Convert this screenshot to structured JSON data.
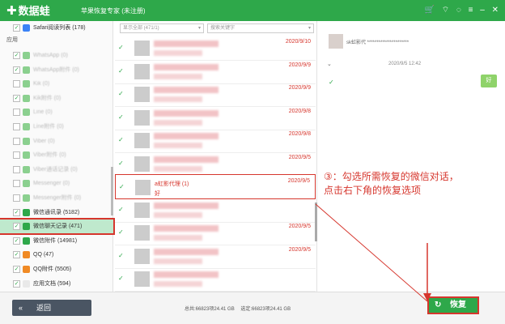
{
  "app": {
    "logo": "数据蛙",
    "title": "苹果恢复专家 (未注册)",
    "window_controls": [
      "cart-icon",
      "wifi-icon",
      "chat-icon",
      "menu-icon",
      "minimize-icon",
      "close-icon"
    ]
  },
  "sidebar": {
    "top_item": "Safari阅读列表 (178)",
    "section": "应用",
    "items": [
      {
        "label": "WhatsApp (0)",
        "checked": true,
        "icon": "app-icon",
        "blurred": true
      },
      {
        "label": "WhatsApp附件 (0)",
        "checked": true,
        "icon": "app-icon",
        "blurred": true
      },
      {
        "label": "Kik (0)",
        "checked": false,
        "icon": "app-icon",
        "blurred": true
      },
      {
        "label": "Kik附件 (0)",
        "checked": true,
        "icon": "app-icon",
        "blurred": true
      },
      {
        "label": "Line (0)",
        "checked": false,
        "icon": "app-icon",
        "blurred": true
      },
      {
        "label": "Line附件 (0)",
        "checked": false,
        "icon": "app-icon",
        "blurred": true
      },
      {
        "label": "Viber (0)",
        "checked": false,
        "icon": "app-icon",
        "blurred": true
      },
      {
        "label": "Viber附件 (0)",
        "checked": false,
        "icon": "app-icon",
        "blurred": true
      },
      {
        "label": "Viber通话记录 (0)",
        "checked": false,
        "icon": "app-icon",
        "blurred": true
      },
      {
        "label": "Messenger (0)",
        "checked": false,
        "icon": "app-icon",
        "blurred": true
      },
      {
        "label": "Messenger附件 (0)",
        "checked": false,
        "icon": "app-icon",
        "blurred": true
      },
      {
        "label": "微信通讯录 (5182)",
        "checked": true,
        "icon": "wechat-icon",
        "blurred": false
      },
      {
        "label": "微信聊天记录 (471)",
        "checked": true,
        "icon": "wechat-icon",
        "blurred": false,
        "active": true
      },
      {
        "label": "微信附件 (14981)",
        "checked": true,
        "icon": "wechat-icon",
        "blurred": false
      },
      {
        "label": "QQ (47)",
        "checked": true,
        "icon": "qq-icon",
        "blurred": false
      },
      {
        "label": "QQ附件 (5505)",
        "checked": true,
        "icon": "qq-icon",
        "blurred": false
      },
      {
        "label": "应用文档 (594)",
        "checked": true,
        "icon": "document-icon",
        "blurred": false
      }
    ]
  },
  "list": {
    "filter_left": "显示全部 (471/1)",
    "filter_right": "搜索关键字",
    "rows": [
      {
        "date": "2020/9/10",
        "selected": false
      },
      {
        "date": "2020/9/9",
        "selected": false
      },
      {
        "date": "2020/9/9",
        "selected": false
      },
      {
        "date": "2020/9/8",
        "selected": false
      },
      {
        "date": "2020/9/8",
        "selected": false
      },
      {
        "date": "2020/9/5",
        "selected": false
      },
      {
        "date": "2020/9/5",
        "selected": true,
        "name": "a虹影代理 (1)",
        "preview": "好"
      },
      {
        "date": "",
        "selected": false
      },
      {
        "date": "2020/9/5",
        "selected": false
      },
      {
        "date": "2020/9/5",
        "selected": false
      },
      {
        "date": "",
        "selected": false
      }
    ]
  },
  "chat": {
    "contact": "sk虹影代 **********************",
    "date": "2020/9/5 12:42",
    "bubble": "好",
    "annotation_line1": "③：勾选所需恢复的微信对话，",
    "annotation_line2": "点击右下角的恢复选项"
  },
  "footer": {
    "back": "返回",
    "total": "总共:66823项24.41 GB",
    "selected": "选定:66823项24.41 GB",
    "recover": "恢复"
  },
  "colors": {
    "brand_green": "#2ea84a",
    "highlight_red": "#d6362d",
    "active_row": "#bfe9cd"
  }
}
